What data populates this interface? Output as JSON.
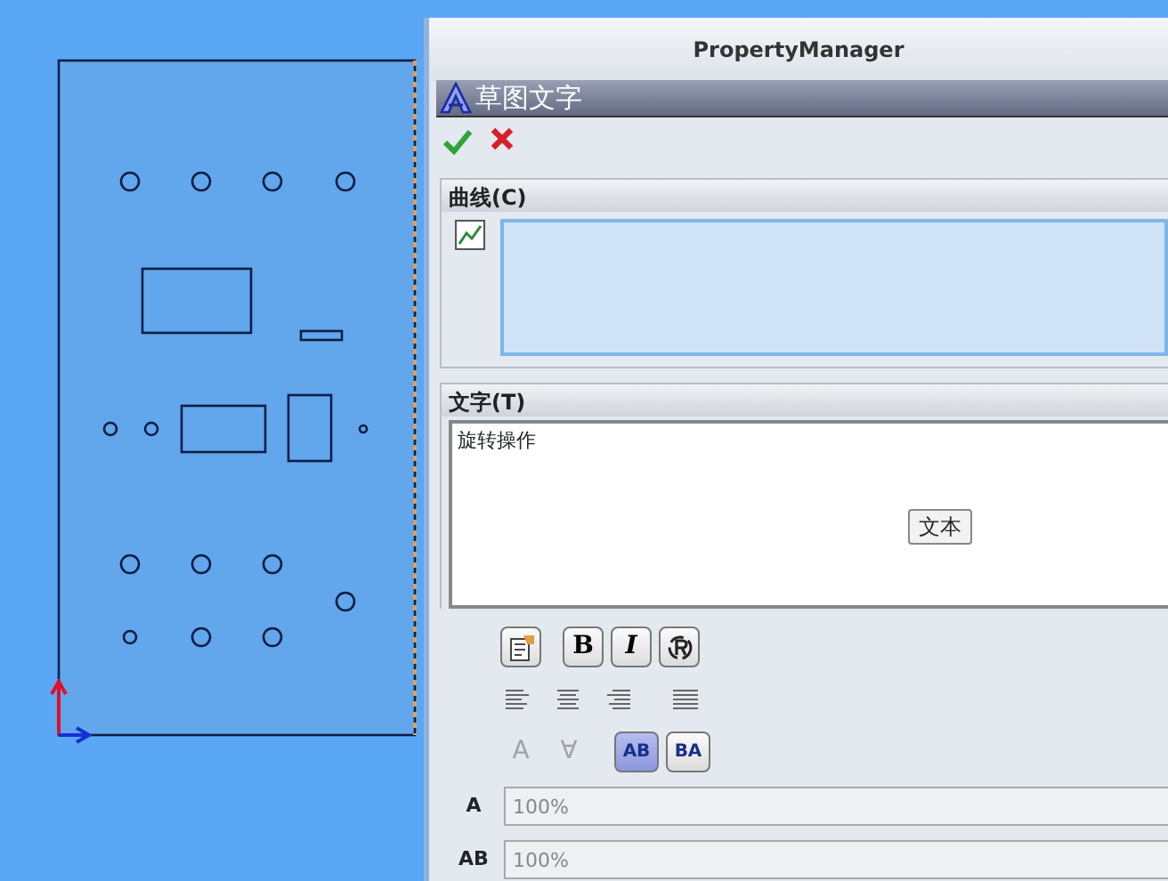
{
  "panel": {
    "title": "PropertyManager"
  },
  "feature": {
    "title": "草图文字"
  },
  "curves_group": {
    "title": "曲线(C)"
  },
  "text_group": {
    "title": "文字(T)",
    "text": "旋转操作",
    "tooltip": "文本"
  },
  "style_buttons": [
    {
      "kind": "font"
    },
    {
      "kind": "bold",
      "label": "B",
      "selected": false
    },
    {
      "kind": "italic",
      "label": "I",
      "selected": false
    },
    {
      "kind": "rotate"
    }
  ],
  "align_buttons": [
    {
      "kind": "left"
    },
    {
      "kind": "center"
    },
    {
      "kind": "right"
    },
    {
      "kind": "justify"
    }
  ],
  "flip_buttons": [
    {
      "kind": "arc",
      "label": "A",
      "disabled": true
    },
    {
      "kind": "arc-down",
      "label": "∀",
      "disabled": true
    },
    {
      "kind": "ltr",
      "label": "AB",
      "selected": true
    },
    {
      "kind": "rtl",
      "label": "BA",
      "selected": false
    }
  ],
  "fields": [
    {
      "icon_text": "A",
      "value": "100%"
    },
    {
      "icon_text": "AB",
      "value": "100%"
    }
  ]
}
